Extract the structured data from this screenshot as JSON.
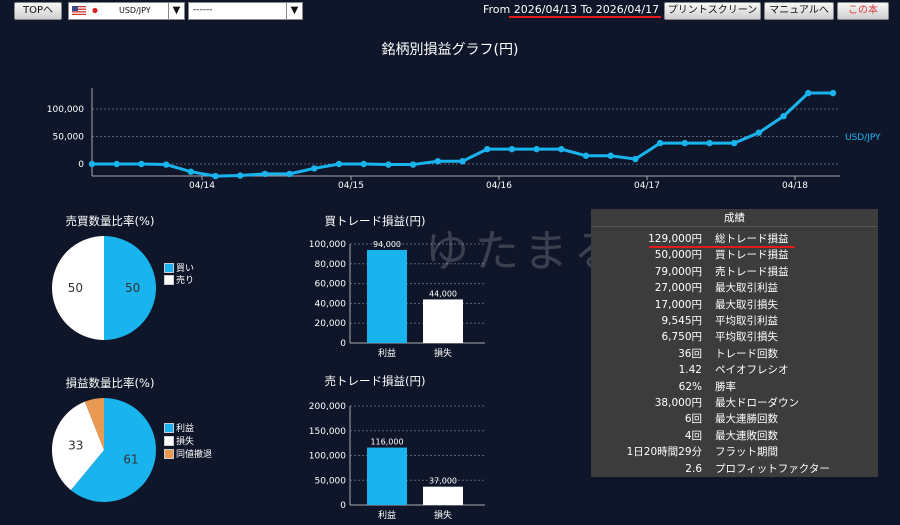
{
  "topbar": {
    "top_button": "TOPへ",
    "symbol_selected": "USD/JPY",
    "second_select": "------",
    "date_range": "From 2026/04/13 To 2026/04/17",
    "print_button": "プリントスクリーン",
    "manual_button": "マニュアルへ",
    "third_button": "この本"
  },
  "main_chart": {
    "title": "銘柄別損益グラフ(円)",
    "series_label": "USD/JPY",
    "y_ticks": [
      "100,000",
      "50,000",
      "0"
    ],
    "x_ticks": [
      "04/14",
      "04/15",
      "04/16",
      "04/17",
      "04/18"
    ],
    "chart_data": {
      "type": "line",
      "series": [
        {
          "name": "USD/JPY",
          "values": [
            0,
            0,
            0,
            -1000,
            -14000,
            -22000,
            -21000,
            -18000,
            -18000,
            -8000,
            0,
            0,
            -1000,
            -1000,
            5000,
            5000,
            27000,
            27000,
            27000,
            27000,
            15000,
            15000,
            9000,
            38000,
            38000,
            38000,
            38000,
            57000,
            87000,
            129000,
            129000
          ]
        }
      ],
      "ylim": [
        -25000,
        130000
      ],
      "color": "#19b4ee"
    }
  },
  "pie_buy_sell": {
    "title": "売買数量比率(%)",
    "labels": [
      "50",
      "50"
    ],
    "legend": [
      "買い",
      "売り"
    ],
    "chart_data": {
      "type": "pie",
      "values": [
        50,
        50
      ],
      "colors": [
        "#19b4ee",
        "#ffffff"
      ]
    }
  },
  "pie_profit_loss": {
    "title": "損益数量比率(%)",
    "labels": [
      "61",
      "33"
    ],
    "legend": [
      "利益",
      "損失",
      "同値撤退"
    ],
    "chart_data": {
      "type": "pie",
      "values": [
        61,
        33,
        6
      ],
      "colors": [
        "#19b4ee",
        "#ffffff",
        "#e89a52"
      ]
    }
  },
  "bar_buy": {
    "title": "買トレード損益(円)",
    "y_ticks": [
      "100,000",
      "80,000",
      "60,000",
      "40,000",
      "20,000",
      "0"
    ],
    "chart_data": {
      "type": "bar",
      "categories": [
        "利益",
        "損失"
      ],
      "values": [
        94000,
        44000
      ],
      "value_labels": [
        "94,000",
        "44,000"
      ],
      "ylim": [
        0,
        100000
      ]
    }
  },
  "bar_sell": {
    "title": "売トレード損益(円)",
    "y_ticks": [
      "200,000",
      "150,000",
      "100,000",
      "50,000",
      "0"
    ],
    "chart_data": {
      "type": "bar",
      "categories": [
        "利益",
        "損失"
      ],
      "values": [
        116000,
        37000
      ],
      "value_labels": [
        "116,000",
        "37,000"
      ],
      "ylim": [
        0,
        200000
      ]
    }
  },
  "stats": {
    "heading": "成績",
    "rows": [
      {
        "value": "129,000円",
        "label": "総トレード損益"
      },
      {
        "value": "50,000円",
        "label": "買トレード損益"
      },
      {
        "value": "79,000円",
        "label": "売トレード損益"
      },
      {
        "value": "27,000円",
        "label": "最大取引利益"
      },
      {
        "value": "17,000円",
        "label": "最大取引損失"
      },
      {
        "value": "9,545円",
        "label": "平均取引利益"
      },
      {
        "value": "6,750円",
        "label": "平均取引損失"
      },
      {
        "value": "36回",
        "label": "トレード回数"
      },
      {
        "value": "1.42",
        "label": "ペイオフレシオ"
      },
      {
        "value": "62%",
        "label": "勝率"
      },
      {
        "value": "38,000円",
        "label": "最大ドローダウン"
      },
      {
        "value": "6回",
        "label": "最大連勝回数"
      },
      {
        "value": "4回",
        "label": "最大連敗回数"
      },
      {
        "value": "1日20時間29分",
        "label": "フラット期間"
      },
      {
        "value": "2.6",
        "label": "プロフィットファクター"
      }
    ]
  },
  "watermark": "ゆたまる"
}
